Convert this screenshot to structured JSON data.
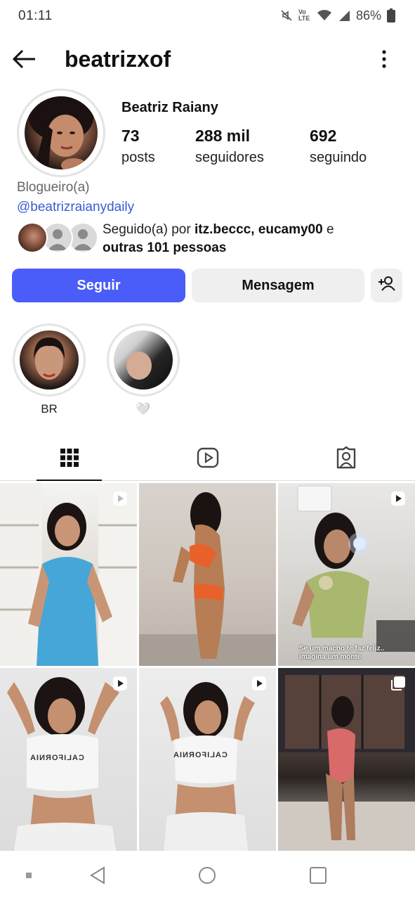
{
  "status_bar": {
    "time": "01:11",
    "battery_percent": "86%",
    "volte_label": "Vo LTE",
    "icons": [
      "mute-icon",
      "volte-icon",
      "wifi-icon",
      "signal-icon",
      "battery-icon"
    ]
  },
  "header": {
    "username": "beatrizxof",
    "back_icon": "arrow-left-icon",
    "menu_icon": "more-vertical-icon"
  },
  "profile": {
    "full_name": "Beatriz Raiany",
    "stats": {
      "posts_count": "73",
      "posts_label": "posts",
      "followers_count": "288 mil",
      "followers_label": "seguidores",
      "following_count": "692",
      "following_label": "seguindo"
    },
    "category": "Blogueiro(a)",
    "threads_link": "@beatrizraianydaily",
    "followed_by": {
      "prefix": "Seguido(a) por ",
      "names": "itz.beccc, eucamy00",
      "connector": " e",
      "others": "outras 101 pessoas"
    }
  },
  "actions": {
    "follow_label": "Seguir",
    "message_label": "Mensagem",
    "add_user_icon": "add-person-icon",
    "accent_color": "#4a5df9"
  },
  "highlights": [
    {
      "label": "BR"
    },
    {
      "label": "🤍"
    }
  ],
  "tabs": [
    {
      "icon": "grid-icon",
      "active": true
    },
    {
      "icon": "reels-icon",
      "active": false
    },
    {
      "icon": "tagged-icon",
      "active": false
    }
  ],
  "posts": [
    {
      "type": "reel",
      "badge_icon": "reel-badge-icon"
    },
    {
      "type": "photo"
    },
    {
      "type": "reel",
      "badge_icon": "reel-badge-icon",
      "caption_line1": "Se um macho te faz feliz..",
      "caption_line2": "imagina um monte"
    },
    {
      "type": "reel",
      "badge_icon": "reel-badge-icon",
      "shirt_text": "CALIFORNIA"
    },
    {
      "type": "reel",
      "badge_icon": "reel-badge-icon",
      "shirt_text": "CALIFORNIA"
    },
    {
      "type": "carousel",
      "badge_icon": "carousel-badge-icon"
    }
  ],
  "navbar": {
    "icons": [
      "menu-icon",
      "back-triangle-icon",
      "home-circle-icon",
      "recents-square-icon"
    ]
  }
}
